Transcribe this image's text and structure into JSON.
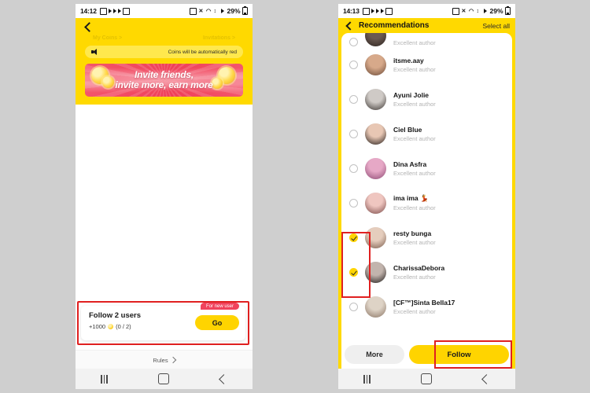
{
  "background_color": "#cfcfcf",
  "accent_yellow": "#ffd900",
  "annotation_red": "#e02020",
  "left_phone": {
    "status_bar": {
      "time": "14:12",
      "battery_percent": "29%",
      "left_icons": [
        "alarm-icon",
        "play-icon",
        "play-icon",
        "play-icon",
        "image-icon"
      ],
      "right_icons": [
        "nfc-icon",
        "mute-icon",
        "wifi-icon",
        "data-icon",
        "signal-icon",
        "battery-icon"
      ]
    },
    "ghost_tabs": [
      "My Coins >",
      "Invitations >"
    ],
    "marquee": {
      "icon": "speaker-icon",
      "text": "Coins will be automatically red"
    },
    "banner": {
      "line1": "Invite friends,",
      "line2": "invite more, earn more"
    },
    "task_card": {
      "badge": "For new user",
      "title": "Follow 2 users",
      "reward": "+1000",
      "coin_icon": "coin-icon",
      "progress": "(0 / 2)",
      "button": "Go"
    },
    "rules": {
      "label": "Rules",
      "chevron": "chevron-right-icon"
    },
    "nav": {
      "recent": "recent-apps-icon",
      "home": "home-icon",
      "back": "back-icon"
    }
  },
  "right_phone": {
    "status_bar": {
      "time": "14:13",
      "battery_percent": "29%"
    },
    "header": {
      "back": "back-arrow-icon",
      "title": "Recommendations",
      "select_all": "Select all"
    },
    "users": [
      {
        "name": "",
        "desc": "Excellent author",
        "checked": false,
        "partial": true,
        "av1": "#6b5a52",
        "av2": "#2d2420"
      },
      {
        "name": "itsme.aay",
        "desc": "Excellent author",
        "checked": false,
        "partial": false,
        "av1": "#d7a98a",
        "av2": "#6b4a38"
      },
      {
        "name": "Ayuni Jolie",
        "desc": "Excellent author",
        "checked": false,
        "partial": false,
        "av1": "#cfcac6",
        "av2": "#3b3531"
      },
      {
        "name": "Ciel Blue",
        "desc": "Excellent author",
        "checked": false,
        "partial": false,
        "av1": "#e8c7b4",
        "av2": "#241d1a"
      },
      {
        "name": "Dina Asfra",
        "desc": "Excellent author",
        "checked": false,
        "partial": false,
        "av1": "#e6a8c6",
        "av2": "#8e4a74"
      },
      {
        "name": "ima ima 💃",
        "desc": "Excellent author",
        "checked": false,
        "partial": false,
        "av1": "#efc6c0",
        "av2": "#7b4a48"
      },
      {
        "name": "resty bunga",
        "desc": "Excellent author",
        "checked": true,
        "partial": false,
        "av1": "#e5cdbd",
        "av2": "#7a5c4c"
      },
      {
        "name": "CharissaDebora",
        "desc": "Excellent author",
        "checked": true,
        "partial": false,
        "av1": "#c2b4ad",
        "av2": "#1e1a18"
      },
      {
        "name": "[CF™]Sinta Bella17",
        "desc": "Excellent author",
        "checked": false,
        "partial": false,
        "av1": "#ded3c6",
        "av2": "#8a7464"
      }
    ],
    "footer": {
      "more": "More",
      "follow": "Follow"
    },
    "nav": {
      "recent": "recent-apps-icon",
      "home": "home-icon",
      "back": "back-icon"
    }
  }
}
